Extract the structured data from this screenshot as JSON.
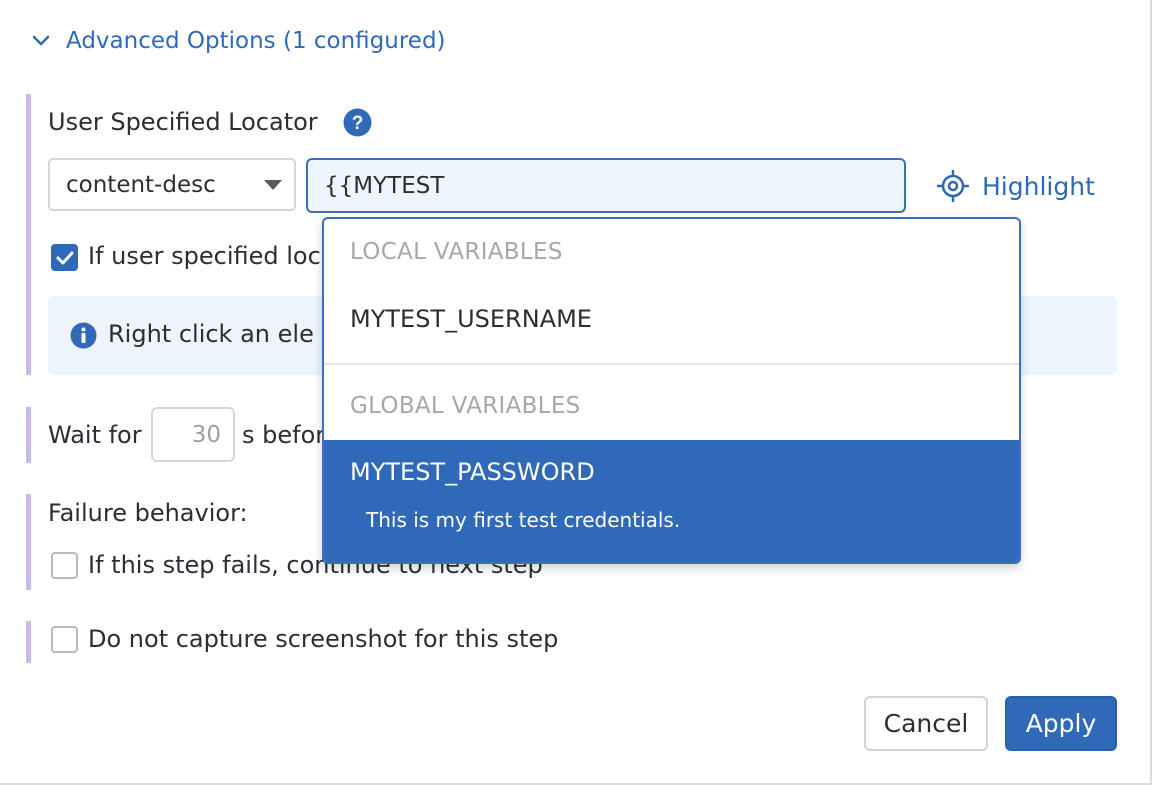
{
  "advanced": {
    "title": "Advanced Options (1 configured)"
  },
  "locator": {
    "label": "User Specified Locator",
    "strategy": "content-desc",
    "value": "{{MYTEST",
    "highlight_label": "Highlight",
    "fallback_label": "If user specified loc"
  },
  "info": {
    "text": "Right click an ele"
  },
  "wait": {
    "prefix": "Wait for",
    "value": "30",
    "suffix": "s befor"
  },
  "failure": {
    "heading": "Failure behavior:",
    "continue_label": "If this step fails, continue to next step"
  },
  "screenshot": {
    "label": "Do not capture screenshot for this step"
  },
  "actions": {
    "cancel_label": "Cancel",
    "apply_label": "Apply"
  },
  "dropdown": {
    "local_heading": "LOCAL VARIABLES",
    "local_items": [
      {
        "name": "MYTEST_USERNAME"
      }
    ],
    "global_heading": "GLOBAL VARIABLES",
    "global_items": [
      {
        "name": "MYTEST_PASSWORD",
        "description": "This is my first test credentials."
      }
    ]
  },
  "colors": {
    "accent": "#3069b7",
    "left_bar": "#c9b8f0",
    "info_bg": "#edf4fb"
  }
}
